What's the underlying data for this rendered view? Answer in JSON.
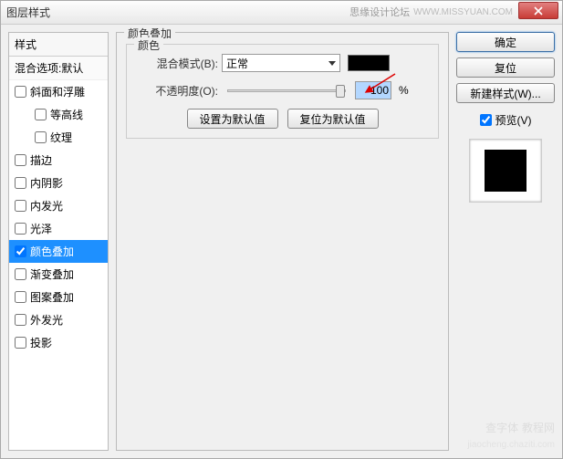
{
  "titlebar": {
    "title": "图层样式",
    "credit": "思缘设计论坛",
    "url": "WWW.MISSYUAN.COM"
  },
  "left": {
    "header": "样式",
    "blend_defaults": "混合选项:默认",
    "items": [
      {
        "label": "斜面和浮雕",
        "checked": false,
        "indent": false
      },
      {
        "label": "等高线",
        "checked": false,
        "indent": true
      },
      {
        "label": "纹理",
        "checked": false,
        "indent": true
      },
      {
        "label": "描边",
        "checked": false,
        "indent": false
      },
      {
        "label": "内阴影",
        "checked": false,
        "indent": false
      },
      {
        "label": "内发光",
        "checked": false,
        "indent": false
      },
      {
        "label": "光泽",
        "checked": false,
        "indent": false
      },
      {
        "label": "颜色叠加",
        "checked": true,
        "indent": false,
        "selected": true
      },
      {
        "label": "渐变叠加",
        "checked": false,
        "indent": false
      },
      {
        "label": "图案叠加",
        "checked": false,
        "indent": false
      },
      {
        "label": "外发光",
        "checked": false,
        "indent": false
      },
      {
        "label": "投影",
        "checked": false,
        "indent": false
      }
    ]
  },
  "center": {
    "section_title": "颜色叠加",
    "group_title": "颜色",
    "blend_mode_label": "混合模式(B):",
    "blend_mode_value": "正常",
    "opacity_label": "不透明度(O):",
    "opacity_value": "100",
    "opacity_unit": "%",
    "color_hex": "#000000",
    "set_default": "设置为默认值",
    "reset_default": "复位为默认值"
  },
  "right": {
    "ok": "确定",
    "cancel": "复位",
    "new_style": "新建样式(W)...",
    "preview_label": "预览(V)",
    "preview_checked": true
  },
  "watermark": {
    "line1": "查字体",
    "line2": "教程网",
    "url": "jiaocheng.chaziti.com"
  }
}
